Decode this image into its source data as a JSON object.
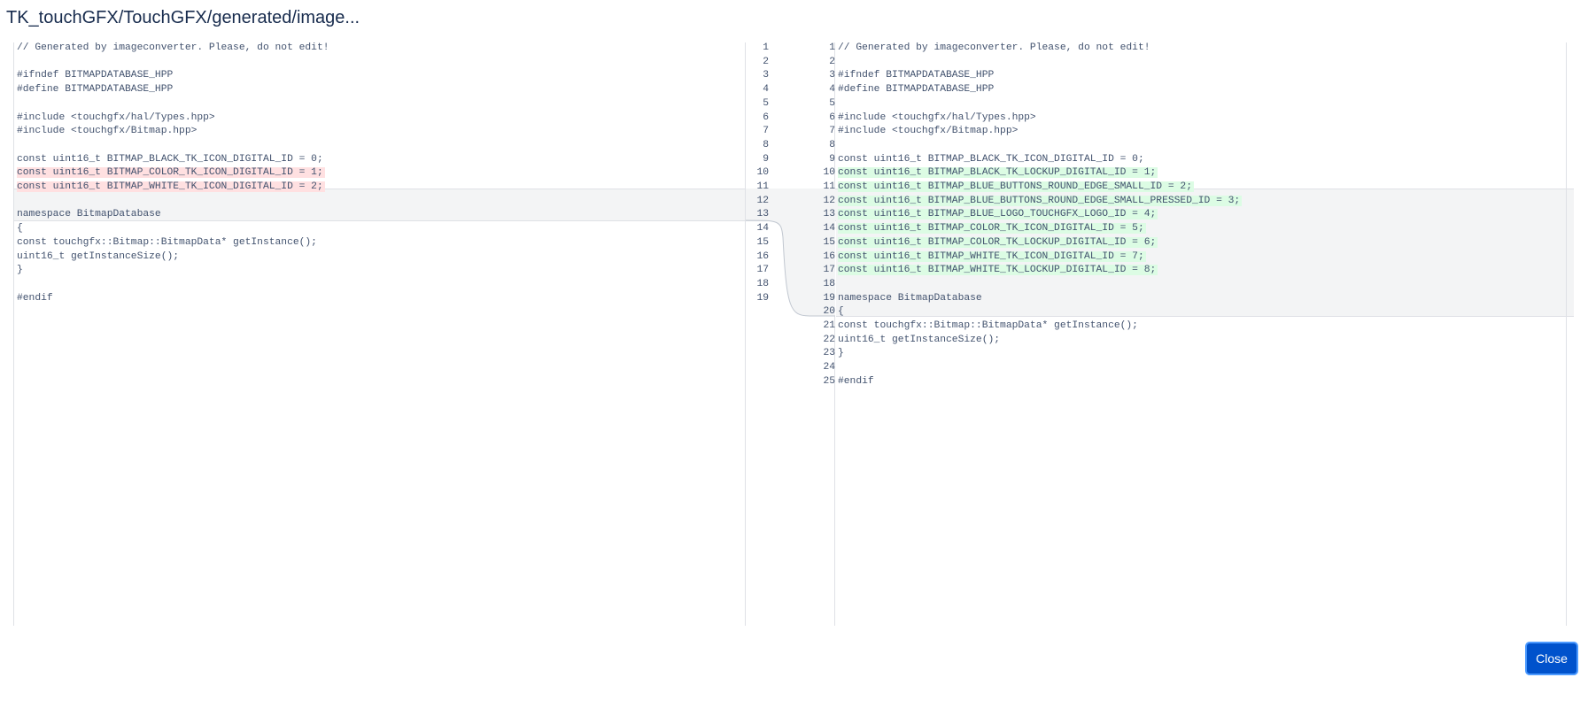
{
  "dialog": {
    "title": "TK_touchGFX/TouchGFX/generated/image...",
    "close_label": "Close"
  },
  "colors": {
    "deleted_bg": "#ffe0e1",
    "added_bg": "#dcfce4",
    "changed_block_bg": "#f3f4f5",
    "primary_button": "#0052cc"
  },
  "diff": {
    "left": {
      "line_numbers": [
        "1",
        "2",
        "3",
        "4",
        "5",
        "6",
        "7",
        "8",
        "9",
        "10",
        "11",
        "12",
        "13",
        "14",
        "15",
        "16",
        "17",
        "18",
        "19"
      ],
      "lines": [
        {
          "text": "// Generated by imageconverter. Please, do not edit!",
          "type": "context"
        },
        {
          "text": "",
          "type": "context"
        },
        {
          "text": "#ifndef BITMAPDATABASE_HPP",
          "type": "context"
        },
        {
          "text": "#define BITMAPDATABASE_HPP",
          "type": "context"
        },
        {
          "text": "",
          "type": "context"
        },
        {
          "text": "#include <touchgfx/hal/Types.hpp>",
          "type": "context"
        },
        {
          "text": "#include <touchgfx/Bitmap.hpp>",
          "type": "context"
        },
        {
          "text": "",
          "type": "context"
        },
        {
          "text": "const uint16_t BITMAP_BLACK_TK_ICON_DIGITAL_ID = 0;",
          "type": "context"
        },
        {
          "text": "const uint16_t BITMAP_COLOR_TK_ICON_DIGITAL_ID = 1;",
          "type": "deleted"
        },
        {
          "text": "const uint16_t BITMAP_WHITE_TK_ICON_DIGITAL_ID = 2;",
          "type": "deleted"
        },
        {
          "text": "",
          "type": "context"
        },
        {
          "text": "namespace BitmapDatabase",
          "type": "context"
        },
        {
          "text": "{",
          "type": "context"
        },
        {
          "text": "const touchgfx::Bitmap::BitmapData* getInstance();",
          "type": "context"
        },
        {
          "text": "uint16_t getInstanceSize();",
          "type": "context"
        },
        {
          "text": "}",
          "type": "context"
        },
        {
          "text": "",
          "type": "context"
        },
        {
          "text": "#endif",
          "type": "context"
        }
      ]
    },
    "right": {
      "line_numbers": [
        "1",
        "2",
        "3",
        "4",
        "5",
        "6",
        "7",
        "8",
        "9",
        "10",
        "11",
        "12",
        "13",
        "14",
        "15",
        "16",
        "17",
        "18",
        "19",
        "20",
        "21",
        "22",
        "23",
        "24",
        "25"
      ],
      "lines": [
        {
          "text": "// Generated by imageconverter. Please, do not edit!",
          "type": "context"
        },
        {
          "text": "",
          "type": "context"
        },
        {
          "text": "#ifndef BITMAPDATABASE_HPP",
          "type": "context"
        },
        {
          "text": "#define BITMAPDATABASE_HPP",
          "type": "context"
        },
        {
          "text": "",
          "type": "context"
        },
        {
          "text": "#include <touchgfx/hal/Types.hpp>",
          "type": "context"
        },
        {
          "text": "#include <touchgfx/Bitmap.hpp>",
          "type": "context"
        },
        {
          "text": "",
          "type": "context"
        },
        {
          "text": "const uint16_t BITMAP_BLACK_TK_ICON_DIGITAL_ID = 0;",
          "type": "context"
        },
        {
          "text": "const uint16_t BITMAP_BLACK_TK_LOCKUP_DIGITAL_ID = 1;",
          "type": "added"
        },
        {
          "text": "const uint16_t BITMAP_BLUE_BUTTONS_ROUND_EDGE_SMALL_ID = 2;",
          "type": "added"
        },
        {
          "text": "const uint16_t BITMAP_BLUE_BUTTONS_ROUND_EDGE_SMALL_PRESSED_ID = 3;",
          "type": "added"
        },
        {
          "text": "const uint16_t BITMAP_BLUE_LOGO_TOUCHGFX_LOGO_ID = 4;",
          "type": "added"
        },
        {
          "text": "const uint16_t BITMAP_COLOR_TK_ICON_DIGITAL_ID = 5;",
          "type": "added"
        },
        {
          "text": "const uint16_t BITMAP_COLOR_TK_LOCKUP_DIGITAL_ID = 6;",
          "type": "added"
        },
        {
          "text": "const uint16_t BITMAP_WHITE_TK_ICON_DIGITAL_ID = 7;",
          "type": "added"
        },
        {
          "text": "const uint16_t BITMAP_WHITE_TK_LOCKUP_DIGITAL_ID = 8;",
          "type": "added"
        },
        {
          "text": "",
          "type": "context"
        },
        {
          "text": "namespace BitmapDatabase",
          "type": "context"
        },
        {
          "text": "{",
          "type": "context"
        },
        {
          "text": "const touchgfx::Bitmap::BitmapData* getInstance();",
          "type": "context"
        },
        {
          "text": "uint16_t getInstanceSize();",
          "type": "context"
        },
        {
          "text": "}",
          "type": "context"
        },
        {
          "text": "",
          "type": "context"
        },
        {
          "text": "#endif",
          "type": "context"
        }
      ]
    }
  }
}
